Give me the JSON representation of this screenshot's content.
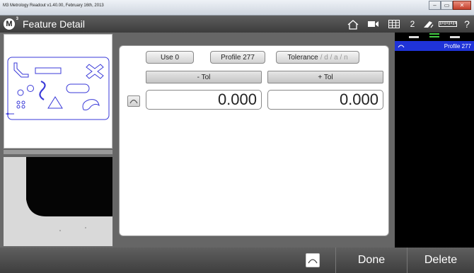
{
  "window": {
    "title": "M3 Metrology Readout  v1.40.00, February 16th, 2013",
    "minimize_icon": "minimize-icon",
    "restore_icon": "restore-icon",
    "close_icon": "close-icon"
  },
  "header": {
    "logo_letter": "M",
    "logo_sup": "3",
    "title": "Feature Detail",
    "icons": [
      "home-icon",
      "video-camera-icon",
      "grid-table-icon",
      "probe-icon",
      "ruler-icon",
      "help-icon"
    ],
    "count": "2",
    "help": "?"
  },
  "panel": {
    "use_label": "Use 0",
    "profile_label": "Profile 277",
    "tolerance_label": "Tolerance",
    "tolerance_suffix": "/ d / a / n",
    "minus_tol_label": "- Tol",
    "plus_tol_label": "+ Tol",
    "minus_tol_value": "0.000",
    "plus_tol_value": "0.000",
    "profile_icon": "arc-icon"
  },
  "feature_list": {
    "tabs": [
      "tab-1",
      "tab-2",
      "tab-3"
    ],
    "selected_item": {
      "icon": "arc-icon",
      "label": "Profile 277"
    }
  },
  "bottom": {
    "profile_icon": "arc-icon",
    "done_label": "Done",
    "delete_label": "Delete"
  },
  "colors": {
    "selection": "#1f33d8",
    "part_outline": "#3a3ad8",
    "active_tab": "#44cc44"
  }
}
